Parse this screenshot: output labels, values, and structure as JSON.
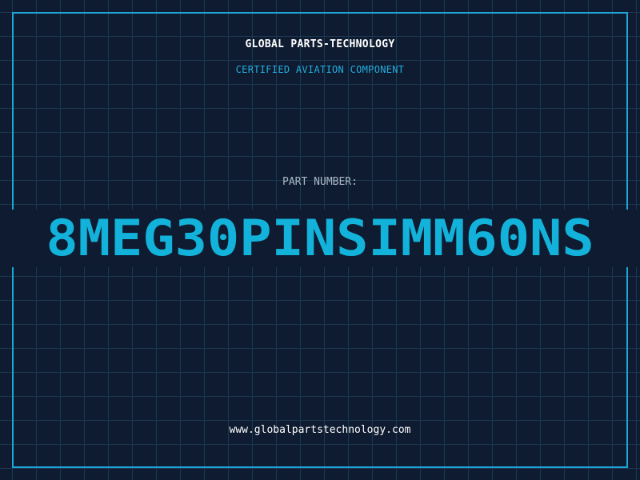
{
  "header": {
    "company": "GLOBAL PARTS-TECHNOLOGY",
    "tagline": "CERTIFIED AVIATION COMPONENT"
  },
  "part": {
    "label": "PART NUMBER:",
    "number": "8MEG30PINSIMM60NS"
  },
  "footer": {
    "website": "www.globalpartstechnology.com"
  },
  "colors": {
    "background": "#0f1b30",
    "grid": "#1c3a52",
    "accent": "#12b2db",
    "text": "#ffffff",
    "muted": "#a9b8c8"
  }
}
